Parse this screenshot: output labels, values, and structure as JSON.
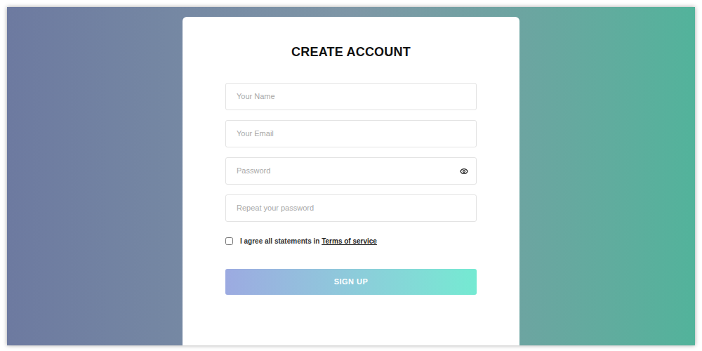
{
  "form": {
    "title": "CREATE ACCOUNT",
    "fields": [
      {
        "placeholder": "Your Name",
        "kind": "text"
      },
      {
        "placeholder": "Your Email",
        "kind": "text"
      },
      {
        "placeholder": "Password",
        "kind": "password"
      },
      {
        "placeholder": "Repeat your password",
        "kind": "text"
      }
    ],
    "agree": {
      "label": "I agree all statements in",
      "link": "Terms of service",
      "checked": false
    },
    "button": "SIGN UP"
  }
}
